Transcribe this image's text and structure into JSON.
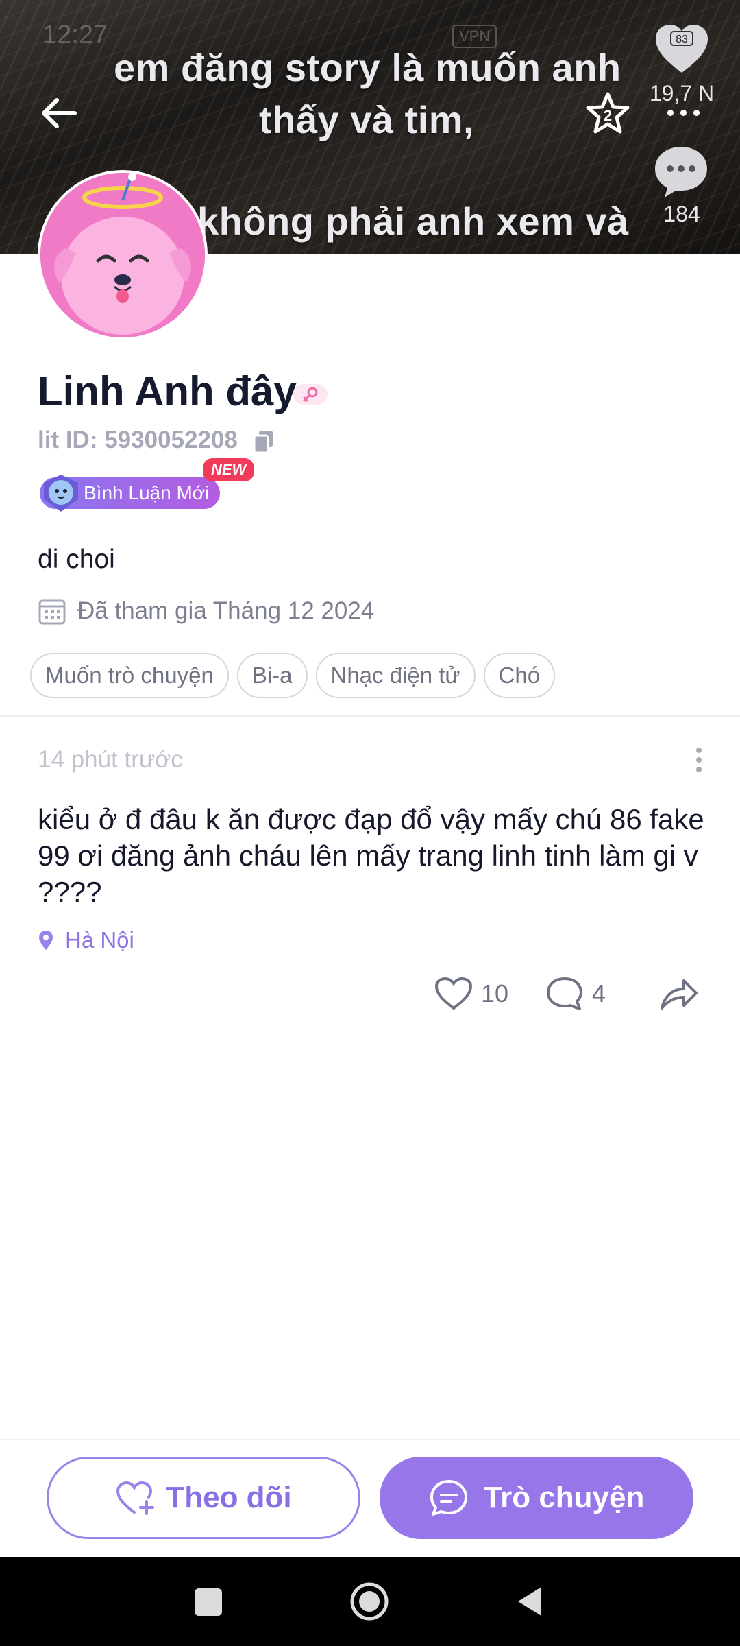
{
  "status_bar": {
    "time": "12:27",
    "vpn": "VPN"
  },
  "story": {
    "lines": [
      "em đăng story là muốn anh",
      "thấy và tim,",
      "không phải anh xem và"
    ],
    "likes": "19,7 N",
    "comments": "184",
    "heart_badge": "83"
  },
  "header": {
    "star_badge": "2"
  },
  "profile": {
    "name": "Linh Anh đây",
    "lit_id": "lit ID: 5930052208",
    "badge_label": "Bình Luận Mới",
    "badge_new": "NEW",
    "bio": "di choi",
    "joined": "Đã tham gia Tháng 12 2024",
    "tags": [
      "Muốn trò chuyện",
      "Bi-a",
      "Nhạc điện tử",
      "Chó"
    ]
  },
  "post": {
    "time": "14 phút trước",
    "body": "kiểu ở đ đâu k ăn được đạp đổ vậy mấy chú 86 fake 99 ơi đăng ảnh cháu lên mấy trang linh tinh làm gi v ????",
    "location": "Hà Nội",
    "likes": "10",
    "comments": "4"
  },
  "buttons": {
    "follow": "Theo dõi",
    "chat": "Trò chuyện"
  },
  "colors": {
    "accent": "#9776ea",
    "accent_text": "#8a6ee6",
    "new_badge": "#f23a5a",
    "avatar_bg": "#f07ac6"
  },
  "icons": [
    "back-arrow-icon",
    "star-icon",
    "heart-icon",
    "more-icon",
    "comment-icon",
    "copy-icon",
    "calendar-icon",
    "location-pin-icon",
    "share-icon",
    "heart-plus-icon",
    "chat-bubble-icon"
  ]
}
